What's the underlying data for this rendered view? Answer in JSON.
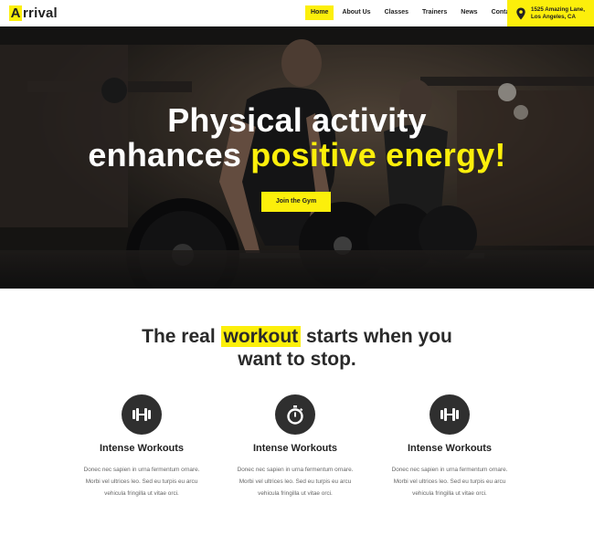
{
  "brand": {
    "logo_initial": "A",
    "logo_rest": "rrival"
  },
  "nav": {
    "items": [
      {
        "label": "Home",
        "active": true
      },
      {
        "label": "About Us"
      },
      {
        "label": "Classes"
      },
      {
        "label": "Trainers"
      },
      {
        "label": "News"
      },
      {
        "label": "Contact"
      }
    ]
  },
  "address": {
    "line1": "1525 Amazing Lane,",
    "line2": "Los Angeles, CA"
  },
  "hero": {
    "line1": "Physical activity",
    "line2_plain": "enhances ",
    "line2_highlight": "positive energy!",
    "cta": "Join the Gym"
  },
  "tagline": {
    "before": "The real ",
    "highlight": "workout",
    "after": " starts when you",
    "line2": "want to stop."
  },
  "features": [
    {
      "icon": "dumbbell-icon",
      "title": "Intense Workouts",
      "line1": "Donec nec sapien in urna fermentum ornare.",
      "line2": "Morbi vel ultrices leo. Sed eu turpis eu arcu",
      "line3": "vehicula fringilla ut vitae orci."
    },
    {
      "icon": "stopwatch-icon",
      "title": "Intense Workouts",
      "line1": "Donec nec sapien in urna fermentum ornare.",
      "line2": "Morbi vel ultrices leo. Sed eu turpis eu arcu",
      "line3": "vehicula fringilla ut vitae orci."
    },
    {
      "icon": "dumbbell-icon",
      "title": "Intense Workouts",
      "line1": "Donec nec sapien in urna fermentum ornare.",
      "line2": "Morbi vel ultrices leo. Sed eu turpis eu arcu",
      "line3": "vehicula fringilla ut vitae orci."
    }
  ],
  "colors": {
    "accent": "#fcef0b",
    "dark": "#2f2f2f"
  }
}
